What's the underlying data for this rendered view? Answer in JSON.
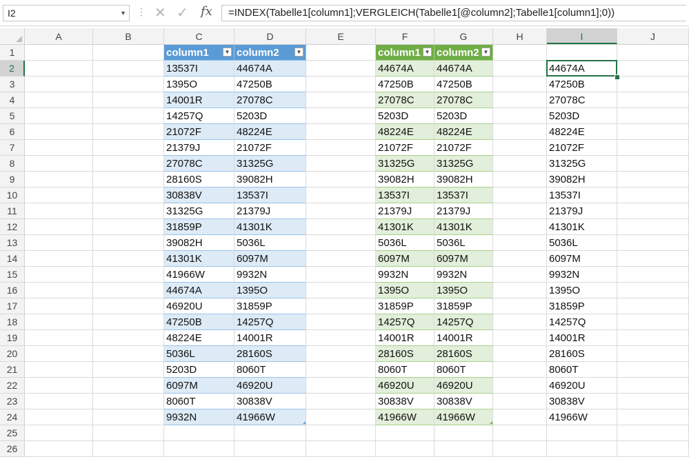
{
  "formula_bar": {
    "name_box": "I2",
    "cancel_icon": "cancel-x-icon",
    "enter_icon": "enter-check-icon",
    "fx_label": "fx",
    "formula": "=INDEX(Tabelle1[column1];VERGLEICH(Tabelle1[@column2];Tabelle1[column1];0))"
  },
  "columns": [
    "A",
    "B",
    "C",
    "D",
    "E",
    "F",
    "G",
    "H",
    "I",
    "J"
  ],
  "selected_column": "I",
  "rows": [
    "1",
    "2",
    "3",
    "4",
    "5",
    "6",
    "7",
    "8",
    "9",
    "10",
    "11",
    "12",
    "13",
    "14",
    "15",
    "16",
    "17",
    "18",
    "19",
    "20",
    "21",
    "22",
    "23",
    "24",
    "25",
    "26"
  ],
  "selected_row": "2",
  "table1": {
    "headers": [
      "column1",
      "column2"
    ],
    "rows": [
      [
        "13537I",
        "44674A"
      ],
      [
        "1395O",
        "47250B"
      ],
      [
        "14001R",
        "27078C"
      ],
      [
        "14257Q",
        "5203D"
      ],
      [
        "21072F",
        "48224E"
      ],
      [
        "21379J",
        "21072F"
      ],
      [
        "27078C",
        "31325G"
      ],
      [
        "28160S",
        "39082H"
      ],
      [
        "30838V",
        "13537I"
      ],
      [
        "31325G",
        "21379J"
      ],
      [
        "31859P",
        "41301K"
      ],
      [
        "39082H",
        "5036L"
      ],
      [
        "41301K",
        "6097M"
      ],
      [
        "41966W",
        "9932N"
      ],
      [
        "44674A",
        "1395O"
      ],
      [
        "46920U",
        "31859P"
      ],
      [
        "47250B",
        "14257Q"
      ],
      [
        "48224E",
        "14001R"
      ],
      [
        "5036L",
        "28160S"
      ],
      [
        "5203D",
        "8060T"
      ],
      [
        "6097M",
        "46920U"
      ],
      [
        "8060T",
        "30838V"
      ],
      [
        "9932N",
        "41966W"
      ]
    ]
  },
  "table2": {
    "headers": [
      "column1",
      "column2"
    ],
    "rows": [
      [
        "44674A",
        "44674A"
      ],
      [
        "47250B",
        "47250B"
      ],
      [
        "27078C",
        "27078C"
      ],
      [
        "5203D",
        "5203D"
      ],
      [
        "48224E",
        "48224E"
      ],
      [
        "21072F",
        "21072F"
      ],
      [
        "31325G",
        "31325G"
      ],
      [
        "39082H",
        "39082H"
      ],
      [
        "13537I",
        "13537I"
      ],
      [
        "21379J",
        "21379J"
      ],
      [
        "41301K",
        "41301K"
      ],
      [
        "5036L",
        "5036L"
      ],
      [
        "6097M",
        "6097M"
      ],
      [
        "9932N",
        "9932N"
      ],
      [
        "1395O",
        "1395O"
      ],
      [
        "31859P",
        "31859P"
      ],
      [
        "14257Q",
        "14257Q"
      ],
      [
        "14001R",
        "14001R"
      ],
      [
        "28160S",
        "28160S"
      ],
      [
        "8060T",
        "8060T"
      ],
      [
        "46920U",
        "46920U"
      ],
      [
        "30838V",
        "30838V"
      ],
      [
        "41966W",
        "41966W"
      ]
    ]
  },
  "column_i": [
    "44674A",
    "47250B",
    "27078C",
    "5203D",
    "48224E",
    "21072F",
    "31325G",
    "39082H",
    "13537I",
    "21379J",
    "41301K",
    "5036L",
    "6097M",
    "9932N",
    "1395O",
    "31859P",
    "14257Q",
    "14001R",
    "28160S",
    "8060T",
    "46920U",
    "30838V",
    "41966W"
  ],
  "colors": {
    "table1_header": "#5b9bd5",
    "table1_band": "#ddebf7",
    "table2_header": "#70ad47",
    "table2_band": "#e2efda",
    "selection": "#217346"
  }
}
